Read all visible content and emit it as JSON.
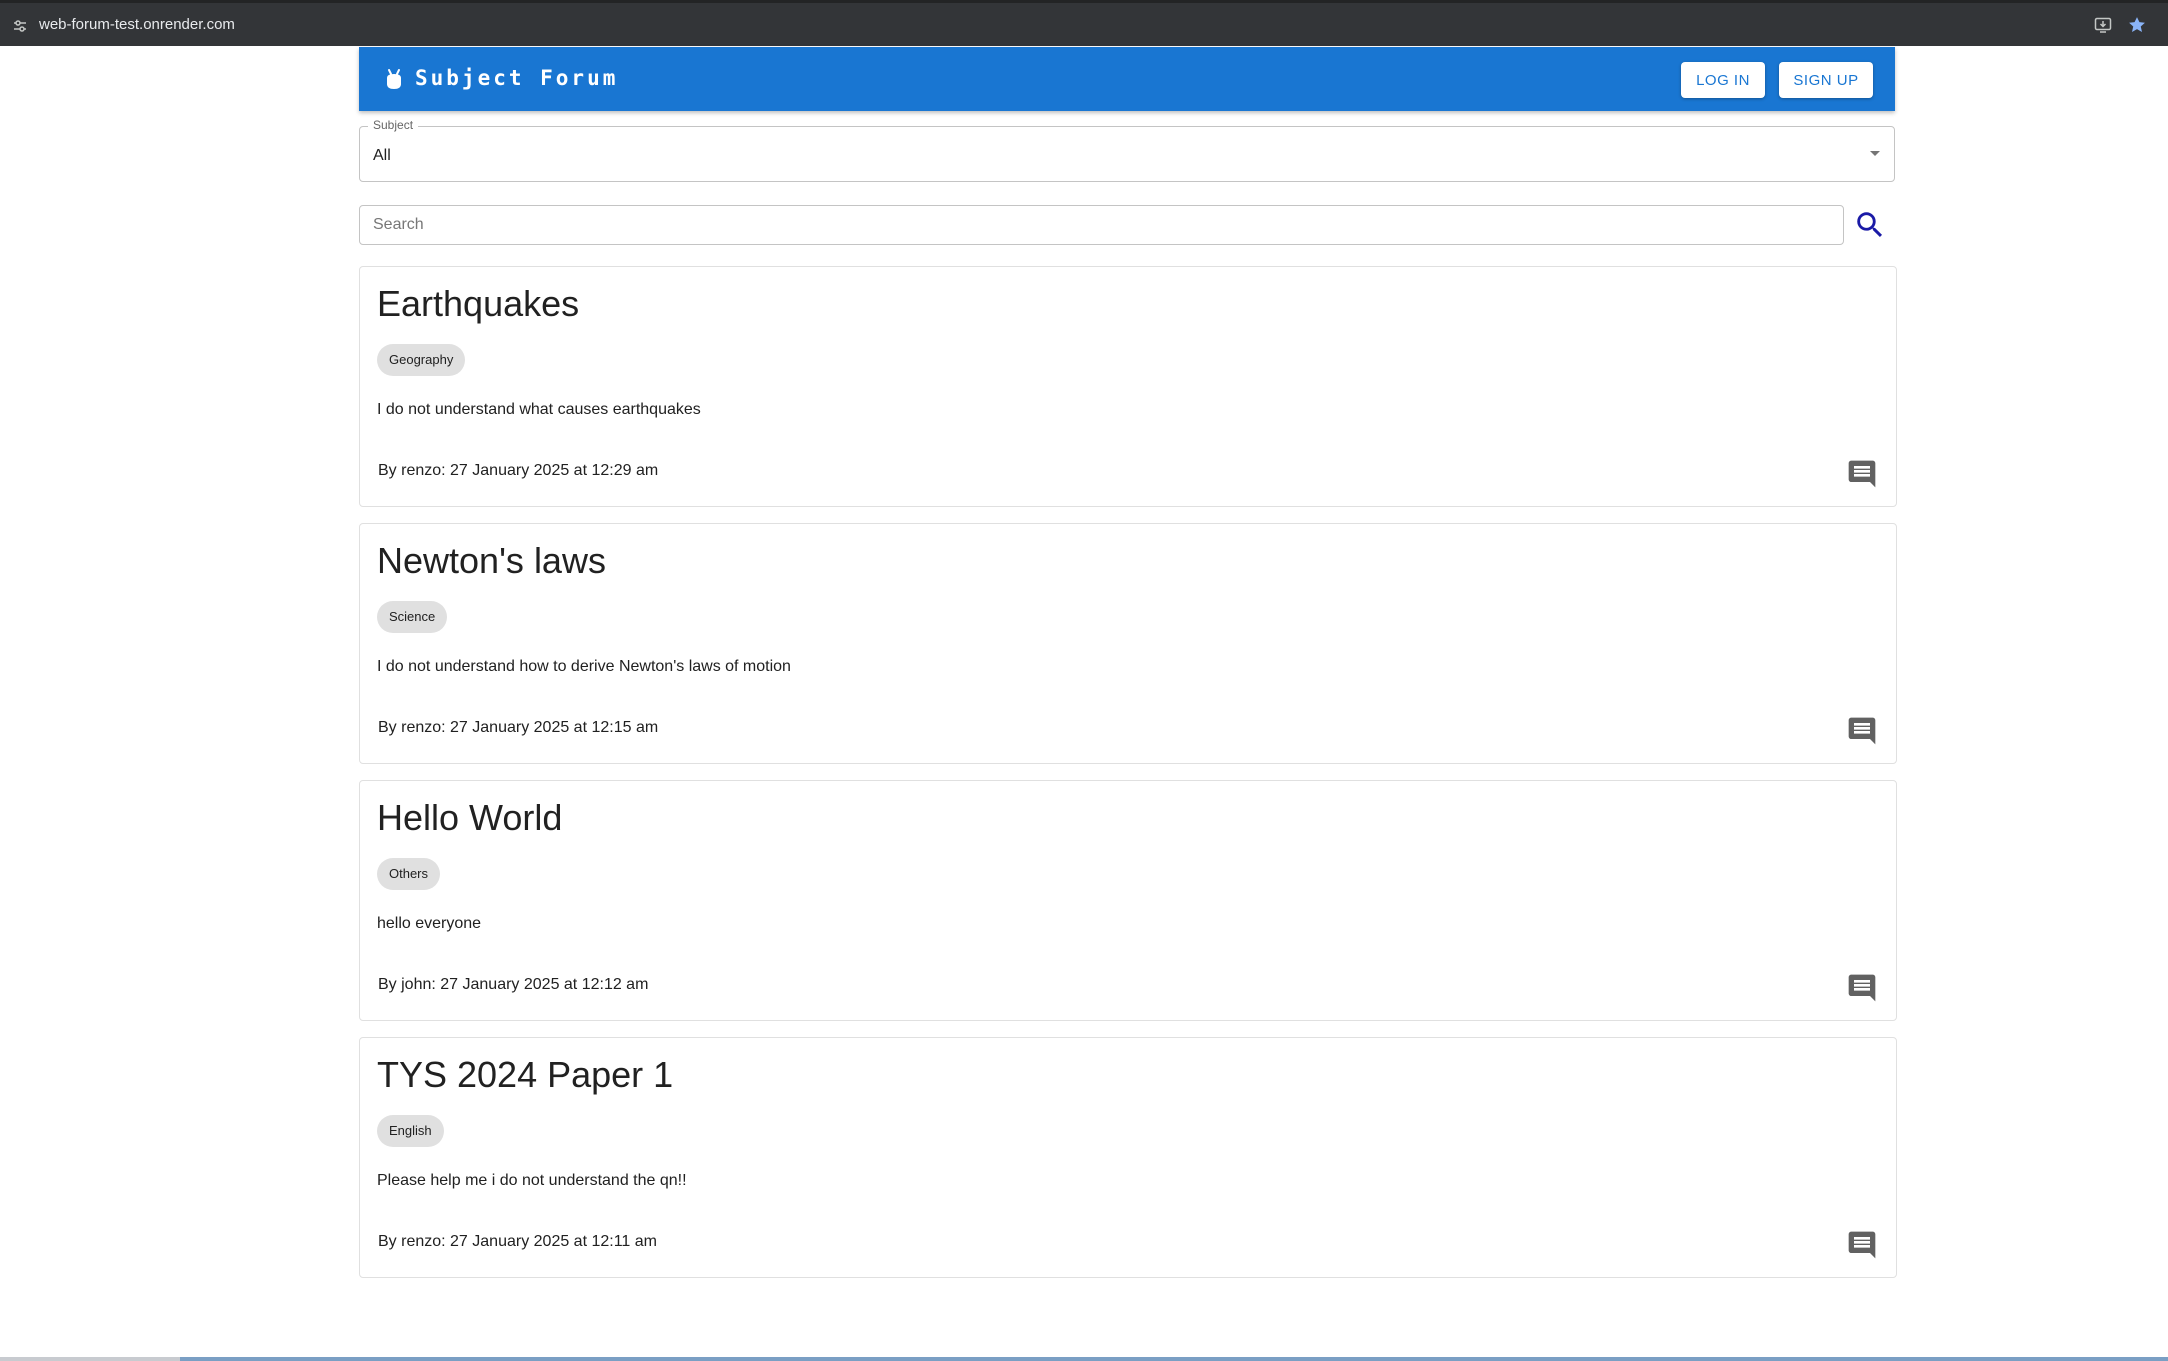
{
  "browser": {
    "url": "web-forum-test.onrender.com"
  },
  "header": {
    "brand": "Subject Forum",
    "login_label": "LOG IN",
    "signup_label": "SIGN UP"
  },
  "filter": {
    "label": "Subject",
    "value": "All"
  },
  "search": {
    "placeholder": "Search"
  },
  "posts": [
    {
      "title": "Earthquakes",
      "subject": "Geography",
      "body": "I do not understand what causes earthquakes",
      "meta": "By renzo: 27 January 2025 at 12:29 am"
    },
    {
      "title": "Newton's laws",
      "subject": "Science",
      "body": "I do not understand how to derive Newton's laws of motion",
      "meta": "By renzo: 27 January 2025 at 12:15 am"
    },
    {
      "title": "Hello World",
      "subject": "Others",
      "body": "hello everyone",
      "meta": "By john: 27 January 2025 at 12:12 am"
    },
    {
      "title": "TYS 2024 Paper 1",
      "subject": "English",
      "body": "Please help me i do not understand the qn!!",
      "meta": "By renzo: 27 January 2025 at 12:11 am"
    }
  ],
  "icons": {
    "browser_site_info": "tune-icon",
    "browser_install": "install-app-icon",
    "browser_bookmark": "star-icon",
    "logo": "logo-icon",
    "select_caret": "caret-down-icon",
    "search": "search-icon",
    "comment": "comment-icon"
  },
  "colors": {
    "appbar": "#1976d2",
    "search_icon": "#1a1aa6",
    "chip": "#e0e0e0",
    "comment_icon": "#616161"
  }
}
